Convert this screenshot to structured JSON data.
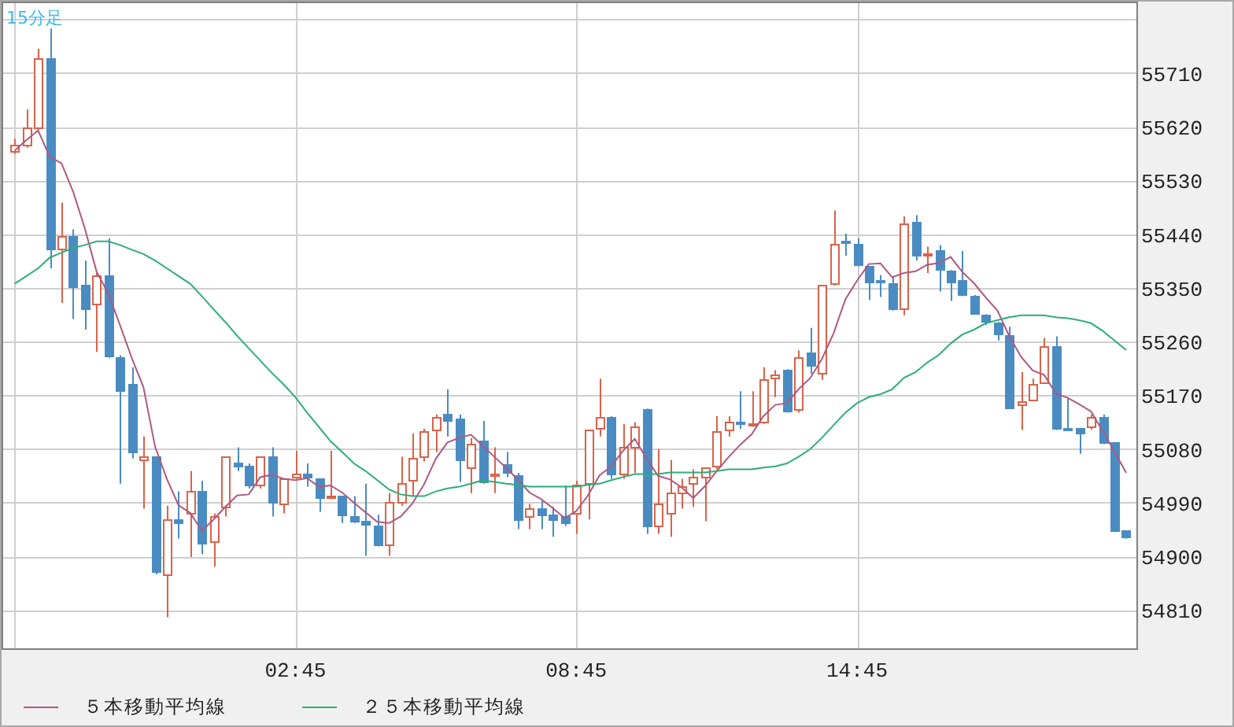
{
  "chart": {
    "chart_data": {
      "type": "candlestick",
      "title": "15分足",
      "grid": true,
      "categories": [
        null,
        null,
        null,
        null,
        null,
        null,
        null,
        null,
        null,
        null,
        null,
        null,
        null,
        null,
        null,
        null,
        null,
        null,
        null,
        null,
        null,
        null,
        null,
        null,
        "02:45",
        null,
        null,
        null,
        null,
        null,
        null,
        null,
        null,
        null,
        null,
        null,
        null,
        null,
        null,
        null,
        null,
        null,
        null,
        null,
        null,
        null,
        null,
        null,
        "08:45",
        null,
        null,
        null,
        null,
        null,
        null,
        null,
        null,
        null,
        null,
        null,
        null,
        null,
        null,
        null,
        null,
        null,
        null,
        null,
        null,
        null,
        null,
        null,
        "14:45",
        null,
        null,
        null,
        null,
        null,
        null,
        null,
        null,
        null,
        null,
        null,
        null,
        null,
        null,
        null,
        null,
        null,
        null,
        null,
        null,
        null,
        null,
        null
      ],
      "ylim": [
        54746,
        55830
      ],
      "yticks": [
        54810,
        54900,
        54990,
        55080,
        55170,
        55260,
        55350,
        55440,
        55530,
        55620,
        55710
      ],
      "ohlc": [
        [
          55578,
          55600,
          55575,
          55591
        ],
        [
          55588,
          55649,
          55585,
          55620
        ],
        [
          55617,
          55751,
          55615,
          55736
        ],
        [
          55736,
          55785,
          55383,
          55412
        ],
        [
          55412,
          55493,
          55325,
          55438
        ],
        [
          55438,
          55448,
          55298,
          55351
        ],
        [
          55354,
          55396,
          55280,
          55312
        ],
        [
          55320,
          55375,
          55243,
          55370
        ],
        [
          55370,
          55433,
          55233,
          55233
        ],
        [
          55235,
          55237,
          55022,
          55175
        ],
        [
          55190,
          55217,
          55064,
          55074
        ],
        [
          55059,
          55101,
          54980,
          55067
        ],
        [
          55067,
          55067,
          54870,
          54872
        ],
        [
          54867,
          54985,
          54798,
          54962
        ],
        [
          54962,
          55009,
          54930,
          54954
        ],
        [
          54970,
          55043,
          54899,
          55009
        ],
        [
          55009,
          55027,
          54904,
          54920
        ],
        [
          54922,
          54972,
          54883,
          54967
        ],
        [
          54980,
          55067,
          54967,
          55067
        ],
        [
          55056,
          55083,
          55043,
          55048
        ],
        [
          55051,
          55056,
          55014,
          55017
        ],
        [
          55017,
          55067,
          55014,
          55067
        ],
        [
          55067,
          55083,
          54967,
          54988
        ],
        [
          54985,
          55030,
          54972,
          55030
        ],
        [
          55030,
          55077,
          55030,
          55040
        ],
        [
          55040,
          55056,
          55017,
          55030
        ],
        [
          55030,
          55030,
          54975,
          54996
        ],
        [
          54998,
          55077,
          54996,
          55001
        ],
        [
          55001,
          55001,
          54956,
          54967
        ],
        [
          54967,
          55001,
          54956,
          54956
        ],
        [
          54959,
          55022,
          54901,
          54951
        ],
        [
          54951,
          54970,
          54917,
          54917
        ],
        [
          54917,
          55006,
          54901,
          54991
        ],
        [
          54988,
          55067,
          54985,
          55022
        ],
        [
          55025,
          55106,
          55001,
          55064
        ],
        [
          55064,
          55114,
          55059,
          55109
        ],
        [
          55109,
          55138,
          55075,
          55135
        ],
        [
          55138,
          55180,
          55101,
          55127
        ],
        [
          55130,
          55138,
          55025,
          55059
        ],
        [
          55046,
          55098,
          55006,
          55088
        ],
        [
          55093,
          55127,
          55022,
          55022
        ],
        [
          55033,
          55083,
          55006,
          55038
        ],
        [
          55054,
          55075,
          55033,
          55038
        ],
        [
          55035,
          55040,
          54946,
          54959
        ],
        [
          54964,
          54988,
          54946,
          54980
        ],
        [
          54980,
          54993,
          54946,
          54967
        ],
        [
          54970,
          54983,
          54933,
          54959
        ],
        [
          54967,
          55019,
          54951,
          54954
        ],
        [
          54970,
          55027,
          54938,
          55019
        ],
        [
          55019,
          55112,
          54962,
          55112
        ],
        [
          55112,
          55198,
          55101,
          55135
        ],
        [
          55135,
          55135,
          55030,
          55035
        ],
        [
          55035,
          55122,
          55030,
          55083
        ],
        [
          55080,
          55125,
          55040,
          55119
        ],
        [
          55148,
          55148,
          54938,
          54948
        ],
        [
          54948,
          55080,
          54938,
          54988
        ],
        [
          54970,
          55062,
          54933,
          55006
        ],
        [
          55004,
          55030,
          54980,
          55017
        ],
        [
          55019,
          55046,
          54983,
          55033
        ],
        [
          55030,
          55048,
          54959,
          55048
        ],
        [
          55048,
          55135,
          55046,
          55109
        ],
        [
          55109,
          55135,
          55101,
          55125
        ],
        [
          55127,
          55177,
          55114,
          55122
        ],
        [
          55117,
          55177,
          55117,
          55122
        ],
        [
          55122,
          55217,
          55122,
          55196
        ],
        [
          55198,
          55212,
          55167,
          55206
        ],
        [
          55214,
          55214,
          55141,
          55141
        ],
        [
          55143,
          55245,
          55141,
          55235
        ],
        [
          55243,
          55283,
          55206,
          55217
        ],
        [
          55206,
          55354,
          55196,
          55354
        ],
        [
          55354,
          55480,
          55354,
          55425
        ],
        [
          55430,
          55441,
          55404,
          55425
        ],
        [
          55425,
          55433,
          55386,
          55388
        ],
        [
          55386,
          55386,
          55330,
          55357
        ],
        [
          55362,
          55372,
          55335,
          55359
        ],
        [
          55359,
          55370,
          55312,
          55312
        ],
        [
          55312,
          55470,
          55304,
          55459
        ],
        [
          55462,
          55472,
          55396,
          55404
        ],
        [
          55404,
          55419,
          55375,
          55409
        ],
        [
          55412,
          55422,
          55344,
          55378
        ],
        [
          55380,
          55380,
          55328,
          55359
        ],
        [
          55362,
          55412,
          55336,
          55336
        ],
        [
          55338,
          55338,
          55306,
          55306
        ],
        [
          55306,
          55306,
          55288,
          55291
        ],
        [
          55293,
          55293,
          55262,
          55270
        ],
        [
          55270,
          55285,
          55148,
          55148
        ],
        [
          55151,
          55209,
          55112,
          55161
        ],
        [
          55161,
          55198,
          55161,
          55190
        ],
        [
          55190,
          55266,
          55190,
          55253
        ],
        [
          55253,
          55269,
          55112,
          55112
        ],
        [
          55114,
          55164,
          55112,
          55112
        ],
        [
          55114,
          55114,
          55072,
          55106
        ],
        [
          55114,
          55138,
          55112,
          55133
        ],
        [
          55133,
          55138,
          55088,
          55088
        ],
        [
          55091,
          55091,
          54941,
          54941
        ],
        [
          54943,
          54943,
          54930,
          54930
        ]
      ],
      "series": [
        {
          "name": "５本移動平均線",
          "type": "line",
          "color": "#b0587f",
          "values": [
            55580,
            55598,
            55614,
            55570,
            55559,
            55511,
            55450,
            55377,
            55341,
            55288,
            55233,
            55184,
            55084,
            55030,
            54986,
            54973,
            54943,
            54962,
            54983,
            55002,
            55004,
            55033,
            55037,
            55030,
            55028,
            55031,
            55017,
            55019,
            55007,
            54990,
            54974,
            54958,
            54956,
            54967,
            54989,
            55021,
            55064,
            55091,
            55099,
            55104,
            55086,
            55067,
            55049,
            55029,
            55007,
            54996,
            54981,
            54964,
            54976,
            55002,
            55036,
            55051,
            55077,
            55097,
            55064,
            55035,
            55029,
            55016,
            54998,
            55018,
            55043,
            55066,
            55087,
            55105,
            55135,
            55154,
            55157,
            55180,
            55199,
            55231,
            55274,
            55331,
            55362,
            55390,
            55391,
            55368,
            55375,
            55378,
            55389,
            55392,
            55402,
            55377,
            55358,
            55334,
            55312,
            55270,
            55235,
            55212,
            55204,
            55173,
            55166,
            55155,
            55143,
            55110,
            55076,
            55040
          ]
        },
        {
          "name": "２５本移動平均線",
          "type": "line",
          "color": "#2bae78",
          "values": [
            55357,
            55370,
            55383,
            55401,
            55409,
            55417,
            55422,
            55428,
            55428,
            55422,
            55414,
            55407,
            55396,
            55383,
            55370,
            55357,
            55336,
            55314,
            55293,
            55270,
            55249,
            55228,
            55207,
            55188,
            55167,
            55141,
            55117,
            55093,
            55075,
            55056,
            55043,
            55028,
            55012,
            55004,
            55001,
            55001,
            55009,
            55014,
            55017,
            55022,
            55028,
            55025,
            55022,
            55020,
            55017,
            55017,
            55017,
            55017,
            55017,
            55020,
            55022,
            55028,
            55033,
            55038,
            55038,
            55038,
            55041,
            55041,
            55041,
            55041,
            55043,
            55046,
            55046,
            55046,
            55049,
            55051,
            55056,
            55067,
            55080,
            55099,
            55120,
            55141,
            55157,
            55167,
            55172,
            55180,
            55199,
            55209,
            55225,
            55238,
            55257,
            55272,
            55280,
            55291,
            55296,
            55301,
            55304,
            55304,
            55304,
            55301,
            55299,
            55296,
            55291,
            55278,
            55262,
            55246
          ]
        }
      ]
    }
  }
}
